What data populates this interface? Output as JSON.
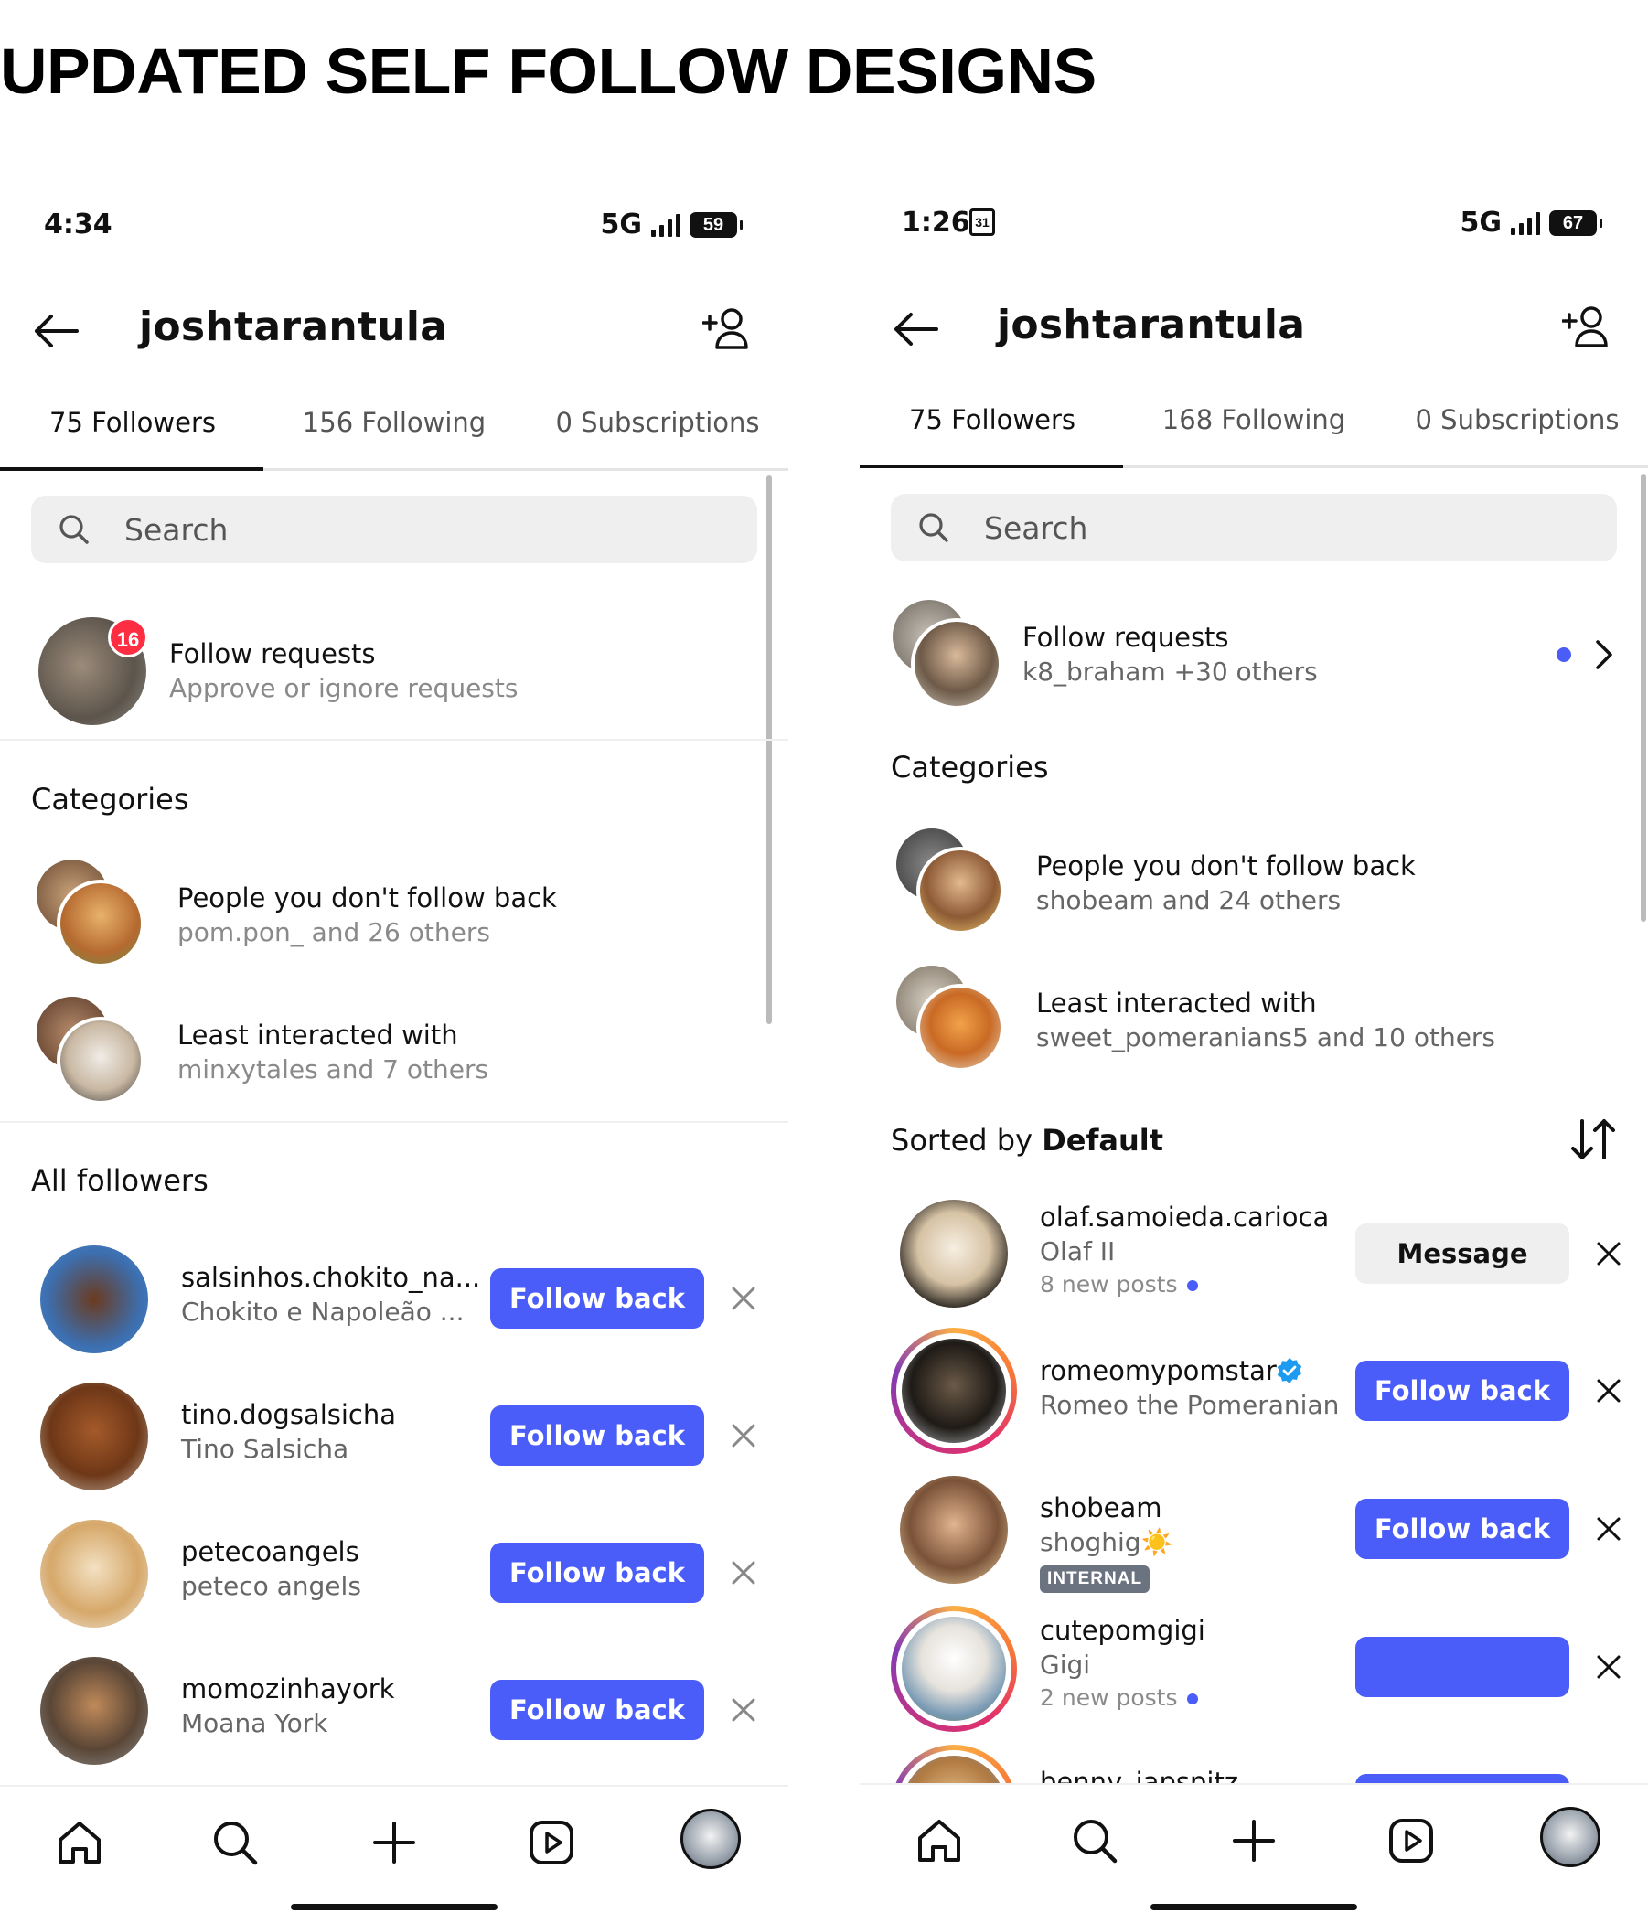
{
  "title": "UPDATED SELF FOLLOW DESIGNS",
  "left": {
    "status": {
      "time": "4:34",
      "network": "5G",
      "battery": "59"
    },
    "username": "joshtarantula",
    "tabs": [
      {
        "label": "75 Followers"
      },
      {
        "label": "156 Following"
      },
      {
        "label": "0 Subscriptions"
      }
    ],
    "search_placeholder": "Search",
    "follow_requests": {
      "badge": "16",
      "title": "Follow requests",
      "subtitle": "Approve or ignore requests"
    },
    "categories_heading": "Categories",
    "categories": [
      {
        "title": "People you don't follow back",
        "subtitle": "pom.pon_ and 26 others"
      },
      {
        "title": "Least interacted with",
        "subtitle": "minxytales and 7 others"
      }
    ],
    "all_followers_heading": "All followers",
    "followers": [
      {
        "username": "salsinhos.chokito_na...",
        "name": "Chokito e Napoleão ...",
        "button": "Follow back"
      },
      {
        "username": "tino.dogsalsicha",
        "name": "Tino Salsicha",
        "button": "Follow back"
      },
      {
        "username": "petecoangels",
        "name": "peteco angels",
        "button": "Follow back"
      },
      {
        "username": "momozinhayork",
        "name": "Moana York",
        "button": "Follow back"
      }
    ]
  },
  "right": {
    "status": {
      "time": "1:26",
      "calendar": "31",
      "network": "5G",
      "battery": "67"
    },
    "username": "joshtarantula",
    "tabs": [
      {
        "label": "75 Followers"
      },
      {
        "label": "168 Following"
      },
      {
        "label": "0 Subscriptions"
      }
    ],
    "search_placeholder": "Search",
    "follow_requests": {
      "title": "Follow requests",
      "subtitle": "k8_braham +30 others"
    },
    "categories_heading": "Categories",
    "categories": [
      {
        "title": "People you don't follow back",
        "subtitle": "shobeam and 24 others"
      },
      {
        "title": "Least interacted with",
        "subtitle": "sweet_pomeranians5 and 10 others"
      }
    ],
    "sorted_prefix": "Sorted by ",
    "sorted_value": "Default",
    "followers": [
      {
        "username": "olaf.samoieda.carioca",
        "name": "Olaf II",
        "meta": "8 new posts",
        "button": "Message"
      },
      {
        "username": "romeomypomstar",
        "name": "Romeo the Pomeranian",
        "button": "Follow back"
      },
      {
        "username": "shobeam",
        "name": "shoghig☀️",
        "tag": "INTERNAL",
        "button": "Follow back"
      },
      {
        "username": "cutepomgigi",
        "name": "Gigi",
        "meta": "2 new posts",
        "button": ""
      },
      {
        "username": "benny_iapspitz",
        "button": ""
      }
    ]
  },
  "colors": {
    "accent": "#4a5df9",
    "badge": "#ff2d42",
    "verified": "#1d9bf0"
  }
}
